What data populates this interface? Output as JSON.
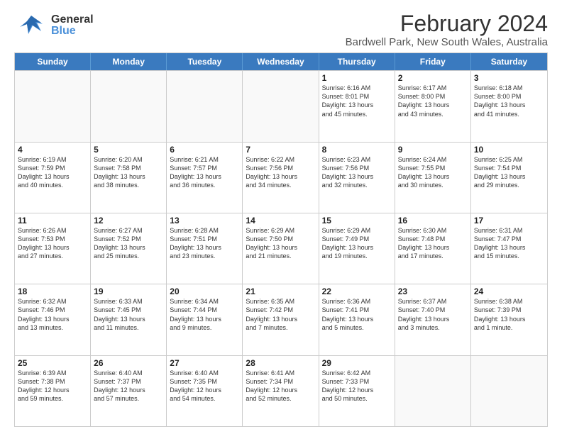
{
  "header": {
    "logo_general": "General",
    "logo_blue": "Blue",
    "main_title": "February 2024",
    "sub_title": "Bardwell Park, New South Wales, Australia"
  },
  "days_of_week": [
    "Sunday",
    "Monday",
    "Tuesday",
    "Wednesday",
    "Thursday",
    "Friday",
    "Saturday"
  ],
  "weeks": [
    [
      {
        "day": "",
        "info": ""
      },
      {
        "day": "",
        "info": ""
      },
      {
        "day": "",
        "info": ""
      },
      {
        "day": "",
        "info": ""
      },
      {
        "day": "1",
        "info": "Sunrise: 6:16 AM\nSunset: 8:01 PM\nDaylight: 13 hours\nand 45 minutes."
      },
      {
        "day": "2",
        "info": "Sunrise: 6:17 AM\nSunset: 8:00 PM\nDaylight: 13 hours\nand 43 minutes."
      },
      {
        "day": "3",
        "info": "Sunrise: 6:18 AM\nSunset: 8:00 PM\nDaylight: 13 hours\nand 41 minutes."
      }
    ],
    [
      {
        "day": "4",
        "info": "Sunrise: 6:19 AM\nSunset: 7:59 PM\nDaylight: 13 hours\nand 40 minutes."
      },
      {
        "day": "5",
        "info": "Sunrise: 6:20 AM\nSunset: 7:58 PM\nDaylight: 13 hours\nand 38 minutes."
      },
      {
        "day": "6",
        "info": "Sunrise: 6:21 AM\nSunset: 7:57 PM\nDaylight: 13 hours\nand 36 minutes."
      },
      {
        "day": "7",
        "info": "Sunrise: 6:22 AM\nSunset: 7:56 PM\nDaylight: 13 hours\nand 34 minutes."
      },
      {
        "day": "8",
        "info": "Sunrise: 6:23 AM\nSunset: 7:56 PM\nDaylight: 13 hours\nand 32 minutes."
      },
      {
        "day": "9",
        "info": "Sunrise: 6:24 AM\nSunset: 7:55 PM\nDaylight: 13 hours\nand 30 minutes."
      },
      {
        "day": "10",
        "info": "Sunrise: 6:25 AM\nSunset: 7:54 PM\nDaylight: 13 hours\nand 29 minutes."
      }
    ],
    [
      {
        "day": "11",
        "info": "Sunrise: 6:26 AM\nSunset: 7:53 PM\nDaylight: 13 hours\nand 27 minutes."
      },
      {
        "day": "12",
        "info": "Sunrise: 6:27 AM\nSunset: 7:52 PM\nDaylight: 13 hours\nand 25 minutes."
      },
      {
        "day": "13",
        "info": "Sunrise: 6:28 AM\nSunset: 7:51 PM\nDaylight: 13 hours\nand 23 minutes."
      },
      {
        "day": "14",
        "info": "Sunrise: 6:29 AM\nSunset: 7:50 PM\nDaylight: 13 hours\nand 21 minutes."
      },
      {
        "day": "15",
        "info": "Sunrise: 6:29 AM\nSunset: 7:49 PM\nDaylight: 13 hours\nand 19 minutes."
      },
      {
        "day": "16",
        "info": "Sunrise: 6:30 AM\nSunset: 7:48 PM\nDaylight: 13 hours\nand 17 minutes."
      },
      {
        "day": "17",
        "info": "Sunrise: 6:31 AM\nSunset: 7:47 PM\nDaylight: 13 hours\nand 15 minutes."
      }
    ],
    [
      {
        "day": "18",
        "info": "Sunrise: 6:32 AM\nSunset: 7:46 PM\nDaylight: 13 hours\nand 13 minutes."
      },
      {
        "day": "19",
        "info": "Sunrise: 6:33 AM\nSunset: 7:45 PM\nDaylight: 13 hours\nand 11 minutes."
      },
      {
        "day": "20",
        "info": "Sunrise: 6:34 AM\nSunset: 7:44 PM\nDaylight: 13 hours\nand 9 minutes."
      },
      {
        "day": "21",
        "info": "Sunrise: 6:35 AM\nSunset: 7:42 PM\nDaylight: 13 hours\nand 7 minutes."
      },
      {
        "day": "22",
        "info": "Sunrise: 6:36 AM\nSunset: 7:41 PM\nDaylight: 13 hours\nand 5 minutes."
      },
      {
        "day": "23",
        "info": "Sunrise: 6:37 AM\nSunset: 7:40 PM\nDaylight: 13 hours\nand 3 minutes."
      },
      {
        "day": "24",
        "info": "Sunrise: 6:38 AM\nSunset: 7:39 PM\nDaylight: 13 hours\nand 1 minute."
      }
    ],
    [
      {
        "day": "25",
        "info": "Sunrise: 6:39 AM\nSunset: 7:38 PM\nDaylight: 12 hours\nand 59 minutes."
      },
      {
        "day": "26",
        "info": "Sunrise: 6:40 AM\nSunset: 7:37 PM\nDaylight: 12 hours\nand 57 minutes."
      },
      {
        "day": "27",
        "info": "Sunrise: 6:40 AM\nSunset: 7:35 PM\nDaylight: 12 hours\nand 54 minutes."
      },
      {
        "day": "28",
        "info": "Sunrise: 6:41 AM\nSunset: 7:34 PM\nDaylight: 12 hours\nand 52 minutes."
      },
      {
        "day": "29",
        "info": "Sunrise: 6:42 AM\nSunset: 7:33 PM\nDaylight: 12 hours\nand 50 minutes."
      },
      {
        "day": "",
        "info": ""
      },
      {
        "day": "",
        "info": ""
      }
    ]
  ]
}
